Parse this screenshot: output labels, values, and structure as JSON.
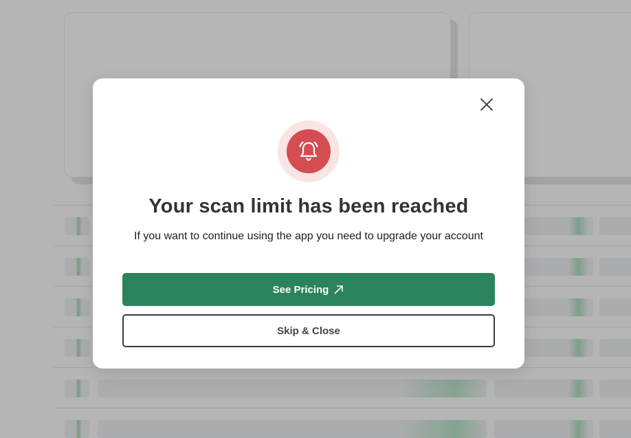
{
  "modal": {
    "title": "Your scan limit has been reached",
    "message": "If you want to continue using the app you need to upgrade your account",
    "primary_button": {
      "label": "See Pricing",
      "icon": "external-arrow-icon"
    },
    "secondary_button": {
      "label": "Skip & Close"
    },
    "close_icon": "close-icon",
    "alert_icon": "alarm-bell-icon"
  },
  "colors": {
    "primary": "#2b835d",
    "alert": "#d34d51",
    "alert_bg": "#fbe4e4",
    "overlay": "rgba(0,0,0,0.26)"
  }
}
